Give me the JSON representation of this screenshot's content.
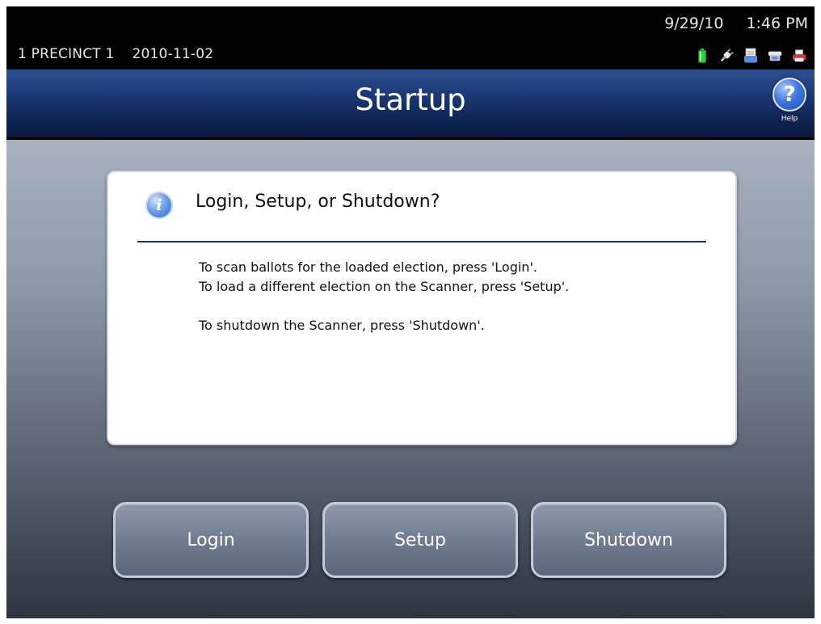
{
  "status": {
    "precinct": "1 PRECINCT 1",
    "election_date": "2010-11-02",
    "date": "9/29/10",
    "time": "1:46 PM",
    "icons": [
      "battery-icon",
      "power-plug-icon",
      "document-icon",
      "ballot-box-icon",
      "printer-icon"
    ]
  },
  "header": {
    "title": "Startup",
    "help_label": "Help",
    "help_glyph": "?"
  },
  "dialog": {
    "info_glyph": "i",
    "title": "Login, Setup, or Shutdown?",
    "lines": [
      "To scan ballots for the loaded election, press 'Login'.",
      "To load a different election on the Scanner, press 'Setup'.",
      "To shutdown the Scanner, press 'Shutdown'."
    ]
  },
  "buttons": {
    "login": "Login",
    "setup": "Setup",
    "shutdown": "Shutdown"
  },
  "colors": {
    "title_bar": "#1d3a78",
    "accent_rule": "#1e2f6e",
    "battery": "#2ecc40"
  }
}
